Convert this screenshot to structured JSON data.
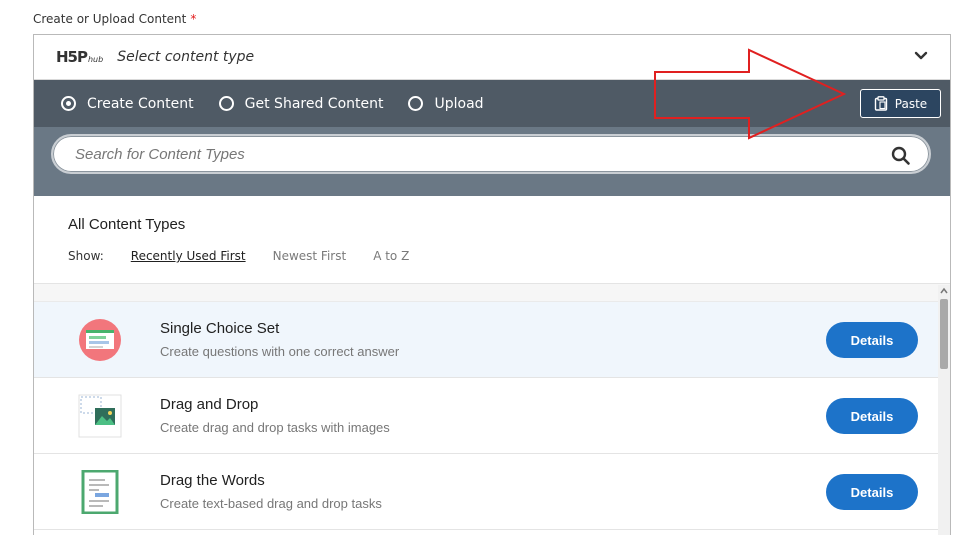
{
  "field": {
    "label": "Create or Upload Content",
    "required_mark": "*"
  },
  "hub": {
    "logo_main": "H5P",
    "logo_sub": "hub",
    "title": "Select content type"
  },
  "tabs": [
    {
      "label": "Create Content",
      "selected": true
    },
    {
      "label": "Get Shared Content",
      "selected": false
    },
    {
      "label": "Upload",
      "selected": false
    }
  ],
  "paste": {
    "label": "Paste"
  },
  "search": {
    "placeholder": "Search for Content Types"
  },
  "list": {
    "title": "All Content Types",
    "show_label": "Show:",
    "sort_options": [
      {
        "label": "Recently Used First",
        "active": true
      },
      {
        "label": "Newest First",
        "active": false
      },
      {
        "label": "A to Z",
        "active": false
      }
    ],
    "items": [
      {
        "title": "Single Choice Set",
        "description": "Create questions with one correct answer",
        "button": "Details",
        "icon": "single-choice-set-icon"
      },
      {
        "title": "Drag and Drop",
        "description": "Create drag and drop tasks with images",
        "button": "Details",
        "icon": "drag-and-drop-icon"
      },
      {
        "title": "Drag the Words",
        "description": "Create text-based drag and drop tasks",
        "button": "Details",
        "icon": "drag-the-words-icon"
      }
    ]
  },
  "colors": {
    "tabbar": "#4f5a65",
    "search_band": "#6a7885",
    "details_button": "#1d73c9",
    "annotation_arrow": "#e02020"
  }
}
